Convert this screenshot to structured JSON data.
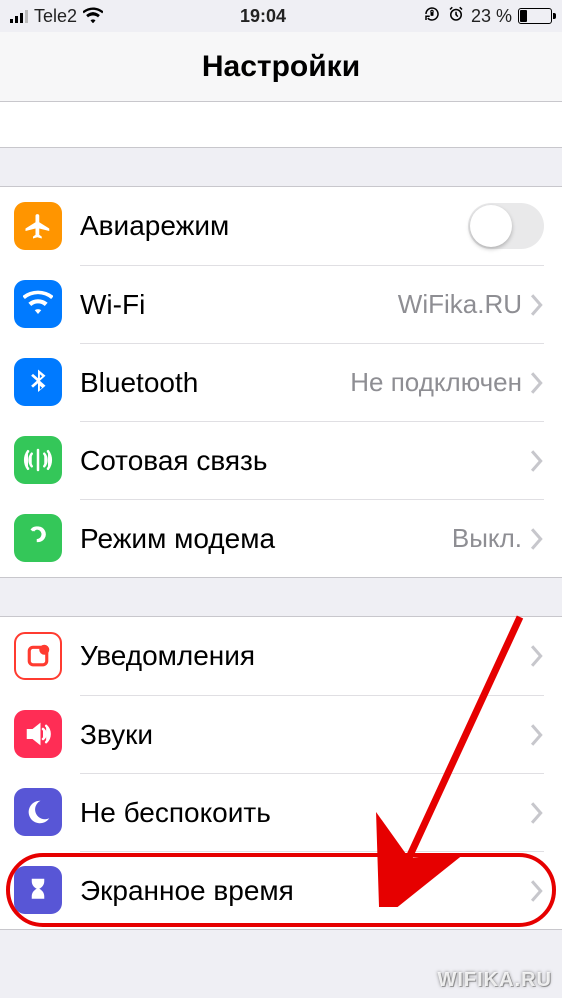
{
  "status_bar": {
    "carrier": "Tele2",
    "time": "19:04",
    "battery_percent": "23 %"
  },
  "nav": {
    "title": "Настройки"
  },
  "group1": [
    {
      "key": "airplane",
      "label": "Авиарежим",
      "control": "switch",
      "on": false
    },
    {
      "key": "wifi",
      "label": "Wi-Fi",
      "value": "WiFika.RU",
      "control": "disclosure"
    },
    {
      "key": "bluetooth",
      "label": "Bluetooth",
      "value": "Не подключен",
      "control": "disclosure"
    },
    {
      "key": "cellular",
      "label": "Сотовая связь",
      "control": "disclosure"
    },
    {
      "key": "hotspot",
      "label": "Режим модема",
      "value": "Выкл.",
      "control": "disclosure"
    }
  ],
  "group2": [
    {
      "key": "notif",
      "label": "Уведомления",
      "control": "disclosure"
    },
    {
      "key": "sounds",
      "label": "Звуки",
      "control": "disclosure"
    },
    {
      "key": "dnd",
      "label": "Не беспокоить",
      "control": "disclosure"
    },
    {
      "key": "screentime",
      "label": "Экранное время",
      "control": "disclosure",
      "highlighted": true
    }
  ],
  "annotation": {
    "arrow_target": "screentime",
    "watermark": "WIFIKA.RU"
  }
}
